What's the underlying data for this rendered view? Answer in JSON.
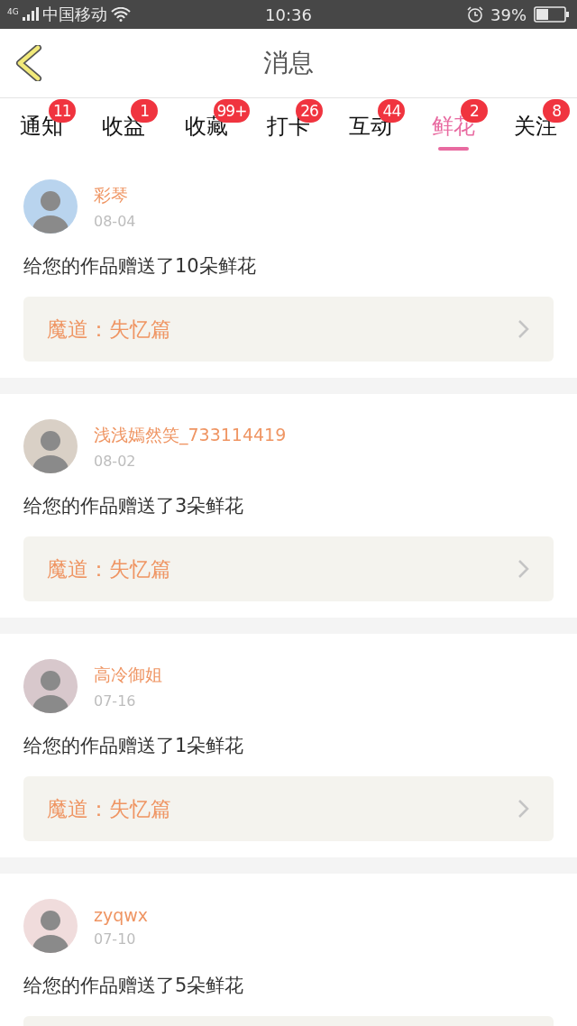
{
  "status_bar": {
    "network": "4G",
    "carrier": "中国移动",
    "time": "10:36",
    "battery": "39%"
  },
  "header": {
    "title": "消息"
  },
  "tabs": [
    {
      "label": "通知",
      "badge": "11",
      "selected": false
    },
    {
      "label": "收益",
      "badge": "1",
      "selected": false
    },
    {
      "label": "收藏",
      "badge": "99+",
      "selected": false
    },
    {
      "label": "打卡",
      "badge": "26",
      "selected": false
    },
    {
      "label": "互动",
      "badge": "44",
      "selected": false
    },
    {
      "label": "鲜花",
      "badge": "2",
      "selected": true
    },
    {
      "label": "关注",
      "badge": "8",
      "selected": false
    }
  ],
  "messages": [
    {
      "name": "彩琴",
      "date": "08-04",
      "text": "给您的作品赠送了10朵鲜花",
      "work": "魔道：失忆篇"
    },
    {
      "name": "浅浅嫣然笑_733114419",
      "date": "08-02",
      "text": "给您的作品赠送了3朵鲜花",
      "work": "魔道：失忆篇"
    },
    {
      "name": "高冷御姐",
      "date": "07-16",
      "text": "给您的作品赠送了1朵鲜花",
      "work": "魔道：失忆篇"
    },
    {
      "name": "zyqwx",
      "date": "07-10",
      "text": "给您的作品赠送了5朵鲜花"
    }
  ]
}
